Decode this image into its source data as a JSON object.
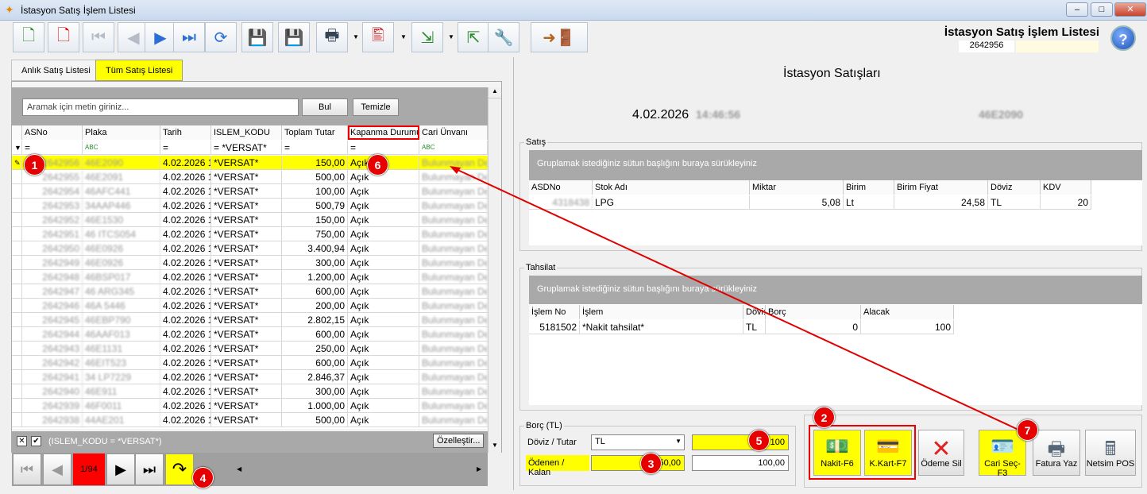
{
  "window": {
    "title": "İstasyon Satış İşlem Listesi",
    "header_title": "İstasyon Satış İşlem Listesi",
    "record_no": "2642956"
  },
  "tabs": [
    {
      "label": "Anlık Satış Listesi"
    },
    {
      "label": "Tüm Satış Listesi"
    }
  ],
  "search": {
    "placeholder": "Aramak için metin giriniz...",
    "btn_find": "Bul",
    "btn_clear": "Temizle"
  },
  "columns": [
    "ASNo",
    "Plaka",
    "Tarih",
    "ISLEM_KODU",
    "Toplam Tutar",
    "Kapanma Durumu",
    "Cari Ünvanı"
  ],
  "filter_row": [
    "=",
    "",
    "=",
    "= *VERSAT*",
    "=",
    "=",
    ""
  ],
  "rows": [
    {
      "tarih": "4.02.2026 1",
      "kod": "*VERSAT*",
      "tutar": "150,00",
      "durum": "Açık"
    },
    {
      "tarih": "4.02.2026 1",
      "kod": "*VERSAT*",
      "tutar": "500,00",
      "durum": "Açık"
    },
    {
      "tarih": "4.02.2026 1",
      "kod": "*VERSAT*",
      "tutar": "100,00",
      "durum": "Açık"
    },
    {
      "tarih": "4.02.2026 1",
      "kod": "*VERSAT*",
      "tutar": "500,79",
      "durum": "Açık"
    },
    {
      "tarih": "4.02.2026 1",
      "kod": "*VERSAT*",
      "tutar": "150,00",
      "durum": "Açık"
    },
    {
      "tarih": "4.02.2026 1",
      "kod": "*VERSAT*",
      "tutar": "750,00",
      "durum": "Açık"
    },
    {
      "tarih": "4.02.2026 1",
      "kod": "*VERSAT*",
      "tutar": "3.400,94",
      "durum": "Açık"
    },
    {
      "tarih": "4.02.2026 1",
      "kod": "*VERSAT*",
      "tutar": "300,00",
      "durum": "Açık"
    },
    {
      "tarih": "4.02.2026 1",
      "kod": "*VERSAT*",
      "tutar": "1.200,00",
      "durum": "Açık"
    },
    {
      "tarih": "4.02.2026 1",
      "kod": "*VERSAT*",
      "tutar": "600,00",
      "durum": "Açık"
    },
    {
      "tarih": "4.02.2026 1",
      "kod": "*VERSAT*",
      "tutar": "200,00",
      "durum": "Açık"
    },
    {
      "tarih": "4.02.2026 1",
      "kod": "*VERSAT*",
      "tutar": "2.802,15",
      "durum": "Açık"
    },
    {
      "tarih": "4.02.2026 1",
      "kod": "*VERSAT*",
      "tutar": "600,00",
      "durum": "Açık"
    },
    {
      "tarih": "4.02.2026 1",
      "kod": "*VERSAT*",
      "tutar": "250,00",
      "durum": "Açık"
    },
    {
      "tarih": "4.02.2026 1",
      "kod": "*VERSAT*",
      "tutar": "600,00",
      "durum": "Açık"
    },
    {
      "tarih": "4.02.2026 1",
      "kod": "*VERSAT*",
      "tutar": "2.846,37",
      "durum": "Açık"
    },
    {
      "tarih": "4.02.2026 1",
      "kod": "*VERSAT*",
      "tutar": "300,00",
      "durum": "Açık"
    },
    {
      "tarih": "4.02.2026 1",
      "kod": "*VERSAT*",
      "tutar": "1.000,00",
      "durum": "Açık"
    },
    {
      "tarih": "4.02.2026 1",
      "kod": "*VERSAT*",
      "tutar": "500,00",
      "durum": "Açık"
    }
  ],
  "filter_text": "(ISLEM_KODU = *VERSAT*)",
  "customize": "Özelleştir...",
  "pager": "1/94",
  "right": {
    "title": "İstasyon Satışları",
    "date": "4.02.2026",
    "satis_legend": "Satış",
    "group_hint": "Gruplamak istediğiniz sütun başlığını buraya sürükleyiniz",
    "satis_cols": [
      "ASDNo",
      "Stok Adı",
      "Miktar",
      "Birim",
      "Birim Fiyat",
      "Döviz",
      "KDV"
    ],
    "satis_row": {
      "stok": "LPG",
      "miktar": "5,08",
      "birim": "Lt",
      "fiyat": "24,58",
      "doviz": "TL",
      "kdv": "20"
    },
    "tahsilat_legend": "Tahsilat",
    "tahsilat_cols": [
      "İşlem No",
      "İşlem",
      "Dövi:",
      "Borç",
      "Alacak"
    ],
    "tahsilat_row": {
      "no": "5181502",
      "islem": "*Nakit tahsilat*",
      "doviz": "TL",
      "borc": "0",
      "alacak": "100"
    },
    "borc_legend": "Borç (TL)",
    "doviz_label": "Döviz / Tutar",
    "doviz_value": "TL",
    "tutar_value": "100",
    "odenen_label": "Ödenen / Kalan",
    "odenen_value": "50,00",
    "kalan_value": "100,00",
    "btn_nakit": "Nakit-F6",
    "btn_kkart": "K.Kart-F7",
    "btn_odeme_sil": "Ödeme Sil",
    "btn_cari": "Cari Seç-F3",
    "btn_fatura": "Fatura Yaz",
    "btn_netsim": "Netsim POS"
  },
  "badges": [
    "1",
    "2",
    "3",
    "4",
    "5",
    "6",
    "7"
  ],
  "colors": {
    "highlight": "#ffff00",
    "badge": "#e60000",
    "arrow": "#e00000"
  }
}
